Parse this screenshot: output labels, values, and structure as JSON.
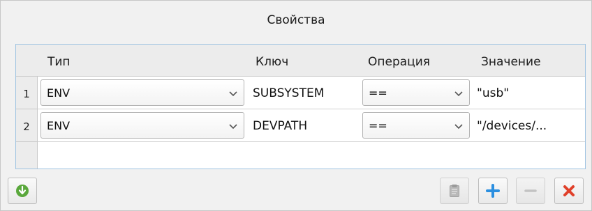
{
  "dialog": {
    "title": "Свойства"
  },
  "table": {
    "columns": [
      "Тип",
      "Ключ",
      "Операция",
      "Значение"
    ],
    "rows": [
      {
        "num": "1",
        "type": "ENV",
        "key": "SUBSYSTEM",
        "operation": "==",
        "value": "\"usb\""
      },
      {
        "num": "2",
        "type": "ENV",
        "key": "DEVPATH",
        "operation": "==",
        "value": "\"/devices/..."
      }
    ]
  },
  "toolbar": {
    "import_icon": "green-down-arrow-icon",
    "paste_icon": "clipboard-icon",
    "add_icon": "plus-icon",
    "remove_icon": "minus-icon",
    "delete_icon": "red-x-icon"
  },
  "colors": {
    "accent_border": "#9fc3e2",
    "add": "#2b8fe0",
    "delete": "#e0402a",
    "import": "#5aa83c"
  }
}
